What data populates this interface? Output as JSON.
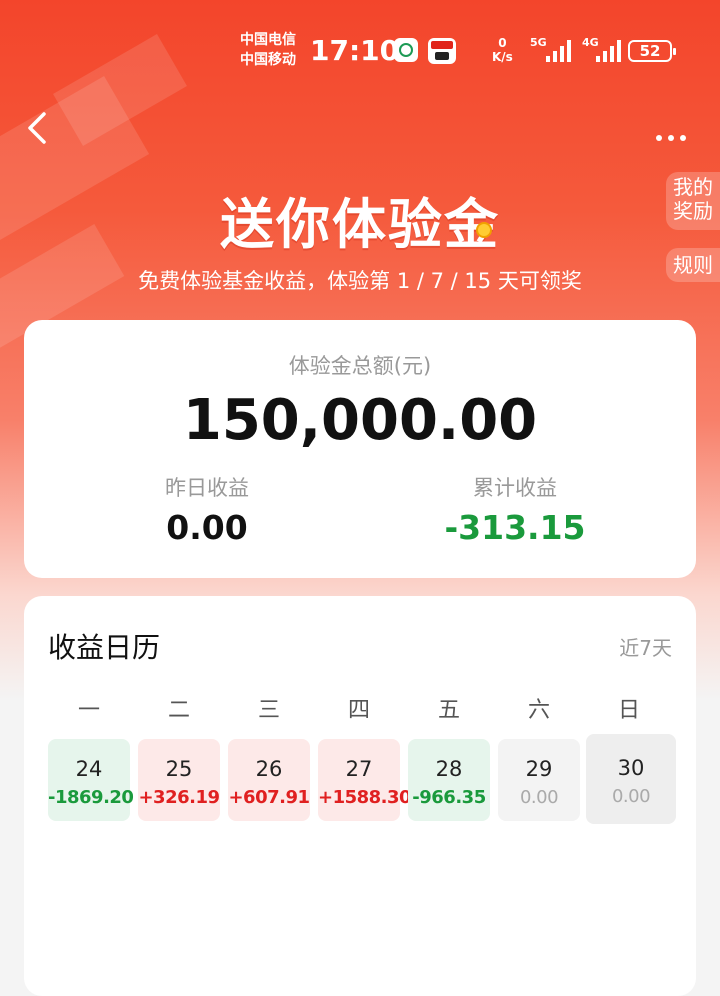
{
  "status_bar": {
    "carrier1": "中国电信",
    "carrier2": "中国移动",
    "time": "17:10",
    "net_speed_value": "0",
    "net_speed_unit": "K/s",
    "signal1_tag": "5G",
    "signal2_tag": "4G",
    "battery": "52"
  },
  "header": {
    "title": "送你体验金",
    "subtitle": "免费体验基金收益，体验第 1 / 7 / 15 天可领奖",
    "side_reward_line1": "我的",
    "side_reward_line2": "奖励",
    "side_rule": "规则"
  },
  "summary": {
    "total_label": "体验金总额(元)",
    "total_amount": "150,000.00",
    "yesterday_label": "昨日收益",
    "yesterday_value": "0.00",
    "cumulative_label": "累计收益",
    "cumulative_value": "-313.15"
  },
  "calendar": {
    "title": "收益日历",
    "range": "近7天",
    "weekdays": [
      "一",
      "二",
      "三",
      "四",
      "五",
      "六",
      "日"
    ],
    "days": [
      {
        "date": "24",
        "value": "-1869.20",
        "kind": "neg"
      },
      {
        "date": "25",
        "value": "+326.19",
        "kind": "pos"
      },
      {
        "date": "26",
        "value": "+607.91",
        "kind": "pos"
      },
      {
        "date": "27",
        "value": "+1588.30",
        "kind": "pos"
      },
      {
        "date": "28",
        "value": "-966.35",
        "kind": "neg"
      },
      {
        "date": "29",
        "value": "0.00",
        "kind": "zero"
      },
      {
        "date": "30",
        "value": "0.00",
        "kind": "today"
      }
    ]
  },
  "colors": {
    "brand_red": "#f3452b",
    "gain_red": "#e02020",
    "loss_green": "#1a9a3c"
  }
}
